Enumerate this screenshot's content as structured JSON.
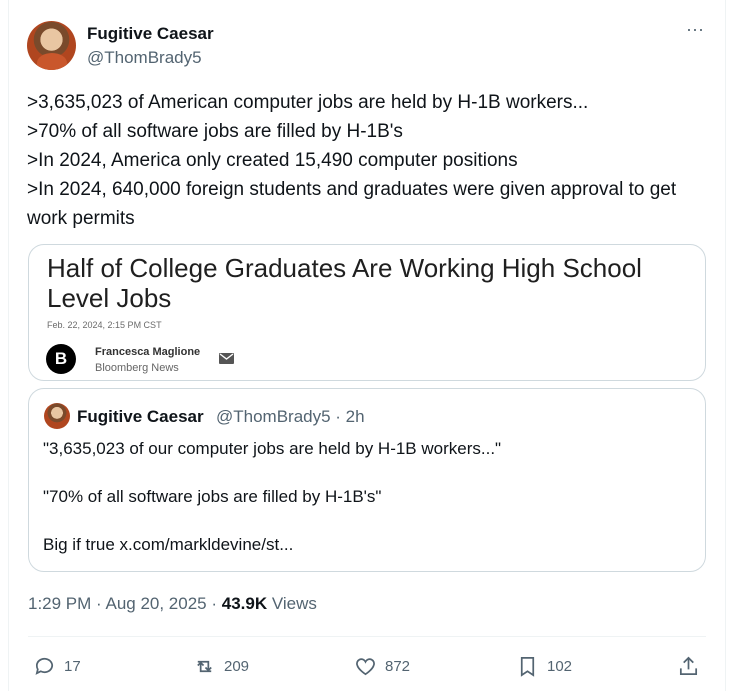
{
  "author": {
    "display_name": "Fugitive Caesar",
    "handle": "@ThomBrady5"
  },
  "tweet": {
    "lines": [
      ">3,635,023 of American computer jobs are held by H-1B workers...",
      ">70% of all software jobs are filled by H-1B's",
      ">In 2024, America only created 15,490 computer positions",
      ">In 2024, 640,000 foreign students and graduates were given approval to get work permits"
    ]
  },
  "link_card": {
    "headline": "Half of College Graduates Are Working High School Level Jobs",
    "date": "Feb. 22, 2024, 2:15 PM CST",
    "author_initial": "B",
    "author_name": "Francesca Maglione",
    "author_org": "Bloomberg News"
  },
  "quote": {
    "display_name": "Fugitive Caesar",
    "meta": "@ThomBrady5 · 2h",
    "lines": [
      "\"3,635,023 of our computer jobs are held by H-1B workers...\"",
      "\"70% of all software jobs are filled by H-1B's\"",
      "Big if true x.com/markldevine/st..."
    ]
  },
  "footer": {
    "time": "1:29 PM · Aug 20, 2025 · ",
    "views_count": "43.9K",
    "views_label": " Views"
  },
  "actions": {
    "replies": "17",
    "reposts": "209",
    "likes": "872",
    "bookmarks": "102"
  },
  "icons": [
    "more-icon",
    "reply-icon",
    "repost-icon",
    "like-icon",
    "bookmark-icon",
    "share-icon",
    "mail-icon"
  ]
}
